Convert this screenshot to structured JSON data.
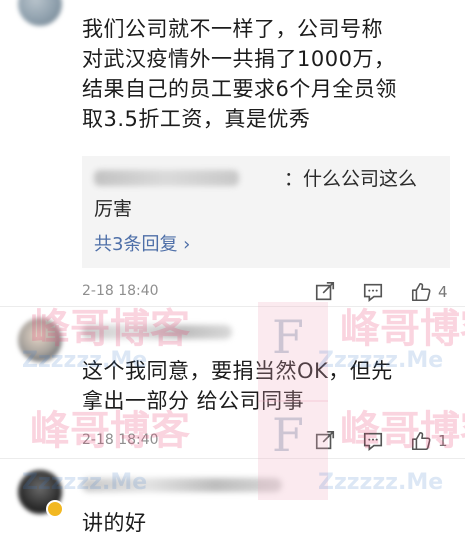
{
  "comments": [
    {
      "text": "我们公司就不一样了，公司号称\n对武汉疫情外一共捐了1000万，\n结果自己的员工要求6个月全员领\n取3.5折工资，真是优秀",
      "reply": {
        "text": "：什么公司这么\n厉害",
        "more_label": "共3条回复 ›"
      },
      "time": "2-18 18:40",
      "likes": "4"
    },
    {
      "text": "这个我同意，要捐当然OK，但先\n拿出一部分 给公司同事",
      "time": "2-18 18:40",
      "likes": "1"
    },
    {
      "text": "讲的好"
    }
  ],
  "watermark": {
    "brand": "峰哥博客",
    "url": "Zzzzzz.Me",
    "letter": "F"
  },
  "icons": {
    "share": "share-icon",
    "comment": "comment-icon",
    "like": "thumbs-up-icon",
    "verified": "verified-badge-icon"
  }
}
